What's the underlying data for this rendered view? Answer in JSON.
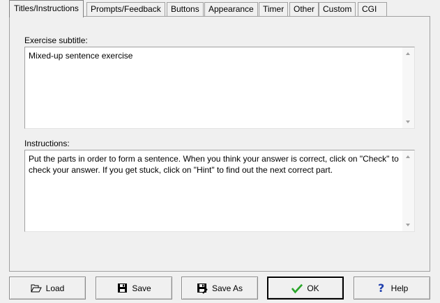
{
  "tabs": [
    {
      "label": "Titles/Instructions",
      "active": true
    },
    {
      "label": "Prompts/Feedback",
      "active": false
    },
    {
      "label": "Buttons",
      "active": false
    },
    {
      "label": "Appearance",
      "active": false
    },
    {
      "label": "Timer",
      "active": false
    },
    {
      "label": "Other",
      "active": false
    },
    {
      "label": "Custom",
      "active": false
    },
    {
      "label": "CGI",
      "active": false
    }
  ],
  "subtitle": {
    "label": "Exercise subtitle:",
    "value": "Mixed-up sentence exercise"
  },
  "instructions": {
    "label": "Instructions:",
    "value": "Put the parts in order to form a sentence. When you think your answer is correct, click on \"Check\" to check your answer. If you get stuck, click on \"Hint\" to find out the next correct part."
  },
  "buttons": {
    "load": "Load",
    "save": "Save",
    "save_as": "Save As",
    "ok": "OK",
    "help": "Help"
  },
  "colors": {
    "background": "#f0f0f0",
    "ok_check": "#2aa52a",
    "help_question": "#1f3fae"
  },
  "icons": {
    "load": "folder-open-icon",
    "save": "floppy-disk-icon",
    "save_as": "floppy-disk-edit-icon",
    "ok": "checkmark-icon",
    "help": "question-mark-icon"
  }
}
